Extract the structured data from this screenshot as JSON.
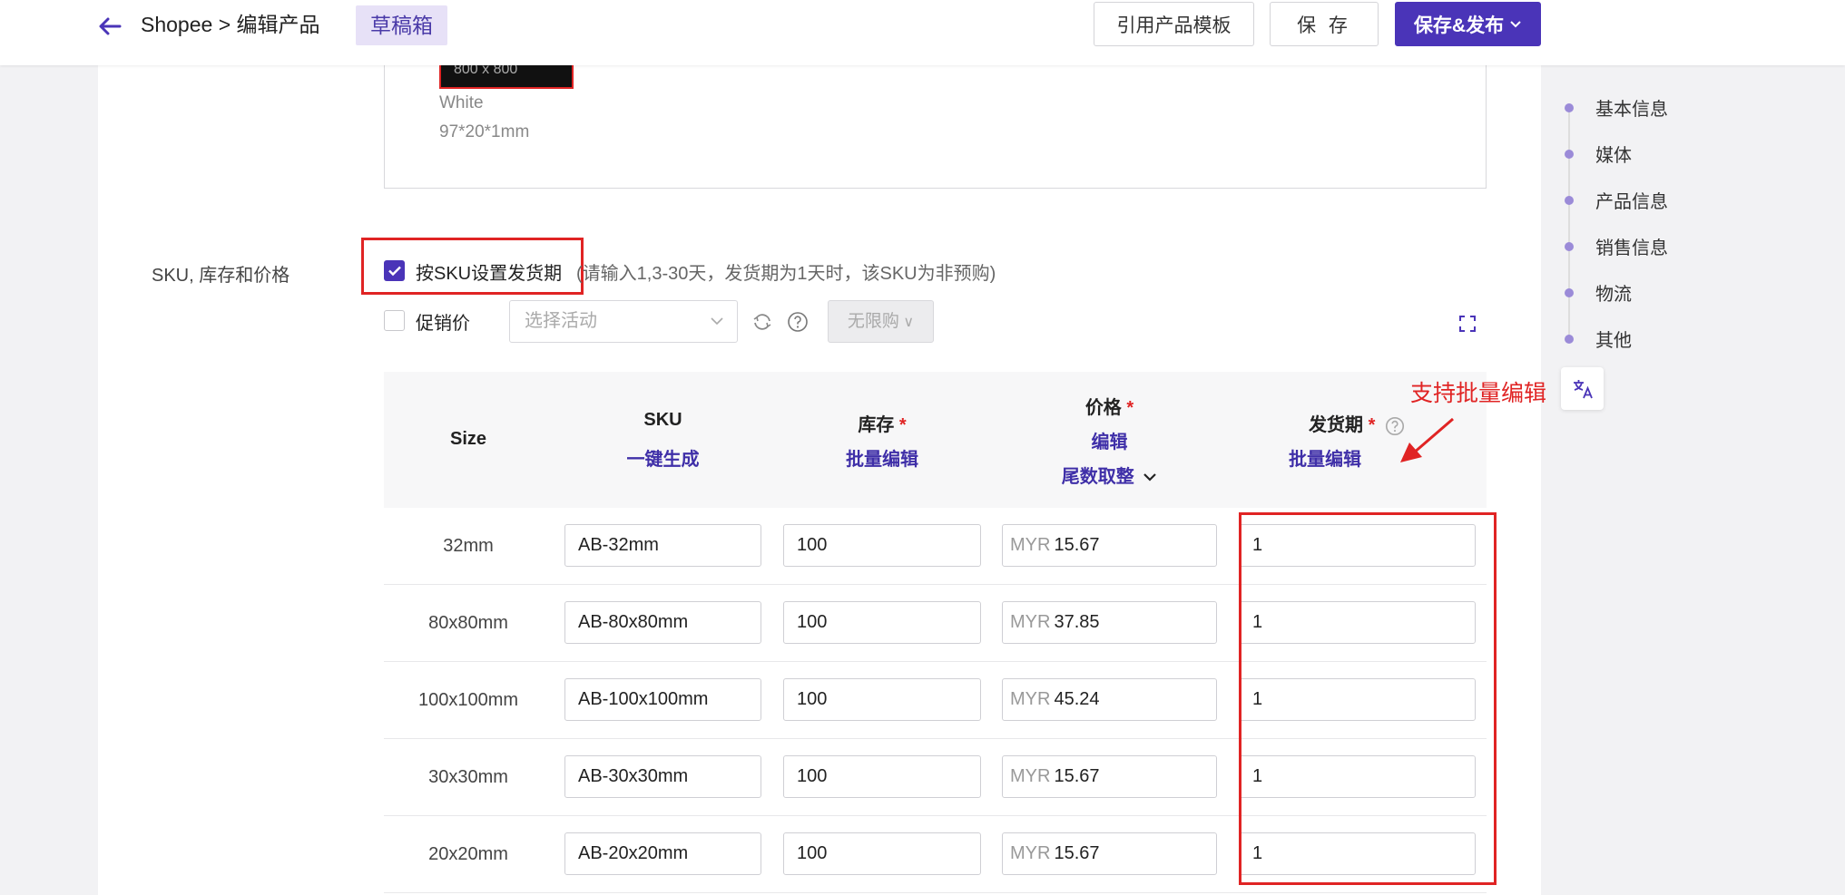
{
  "header": {
    "breadcrumb": "Shopee > 编辑产品",
    "draft_badge": "草稿箱",
    "template_btn": "引用产品模板",
    "save_btn": "保 存",
    "publish_btn": "保存&发布"
  },
  "media": {
    "thumb_text": "800 x 800",
    "color": "White",
    "dimension": "97*20*1mm"
  },
  "sku_section": {
    "label": "SKU, 库存和价格",
    "by_sku_checkbox": "按SKU设置发货期",
    "by_sku_hint": "(请输入1,3-30天，发货期为1天时，该SKU为非预购)",
    "promo_checkbox": "促销价",
    "activity_placeholder": "选择活动",
    "limit_placeholder": "无限购"
  },
  "table": {
    "headers": {
      "size": "Size",
      "sku": "SKU",
      "sku_action": "一键生成",
      "stock": "库存",
      "stock_action": "批量编辑",
      "price": "价格",
      "price_action": "编辑",
      "price_round": "尾数取整",
      "days": "发货期",
      "days_action": "批量编辑",
      "required_mark": "*"
    },
    "currency": "MYR",
    "rows": [
      {
        "size": "32mm",
        "sku": "AB-32mm",
        "stock": "100",
        "price": "15.67",
        "days": "1"
      },
      {
        "size": "80x80mm",
        "sku": "AB-80x80mm",
        "stock": "100",
        "price": "37.85",
        "days": "1"
      },
      {
        "size": "100x100mm",
        "sku": "AB-100x100mm",
        "stock": "100",
        "price": "45.24",
        "days": "1"
      },
      {
        "size": "30x30mm",
        "sku": "AB-30x30mm",
        "stock": "100",
        "price": "15.67",
        "days": "1"
      },
      {
        "size": "20x20mm",
        "sku": "AB-20x20mm",
        "stock": "100",
        "price": "15.67",
        "days": "1"
      }
    ]
  },
  "side_nav": {
    "items": [
      {
        "label": "基本信息"
      },
      {
        "label": "媒体"
      },
      {
        "label": "产品信息"
      },
      {
        "label": "销售信息"
      },
      {
        "label": "物流"
      },
      {
        "label": "其他"
      }
    ]
  },
  "annotation": "支持批量编辑",
  "colors": {
    "primary": "#4a34b8",
    "highlight_red": "#e02424",
    "badge_bg": "#e7e1f7"
  }
}
